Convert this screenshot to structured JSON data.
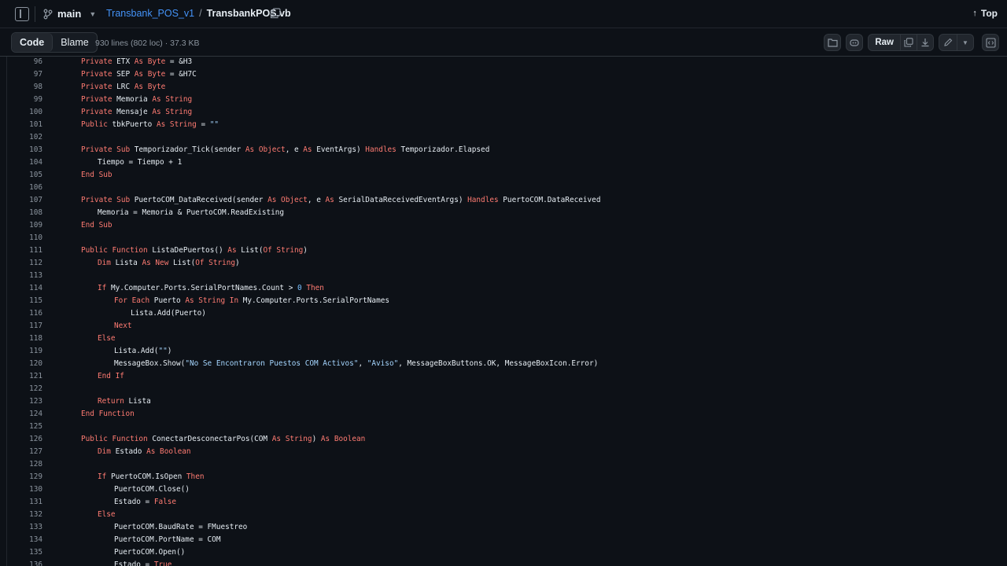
{
  "topbar": {
    "branch": "main",
    "repo": "Transbank_POS_v1",
    "separator": "/",
    "file": "TransbankPOS.vb",
    "top_label": "Top"
  },
  "filebar": {
    "tab_code": "Code",
    "tab_blame": "Blame",
    "info": "930 lines (802 loc) · 37.3 KB",
    "raw_label": "Raw"
  },
  "code": {
    "lines": [
      {
        "n": "96",
        "indent": 1,
        "tokens": [
          [
            "kw",
            "Private"
          ],
          [
            "t",
            " ETX "
          ],
          [
            "kw",
            "As"
          ],
          [
            "t",
            " "
          ],
          [
            "kw",
            "Byte"
          ],
          [
            "t",
            " = &H3"
          ]
        ]
      },
      {
        "n": "97",
        "indent": 1,
        "tokens": [
          [
            "kw",
            "Private"
          ],
          [
            "t",
            " SEP "
          ],
          [
            "kw",
            "As"
          ],
          [
            "t",
            " "
          ],
          [
            "kw",
            "Byte"
          ],
          [
            "t",
            " = &H7C"
          ]
        ]
      },
      {
        "n": "98",
        "indent": 1,
        "tokens": [
          [
            "kw",
            "Private"
          ],
          [
            "t",
            " LRC "
          ],
          [
            "kw",
            "As"
          ],
          [
            "t",
            " "
          ],
          [
            "kw",
            "Byte"
          ]
        ]
      },
      {
        "n": "99",
        "indent": 1,
        "tokens": [
          [
            "kw",
            "Private"
          ],
          [
            "t",
            " Memoria "
          ],
          [
            "kw",
            "As"
          ],
          [
            "t",
            " "
          ],
          [
            "kw",
            "String"
          ]
        ]
      },
      {
        "n": "100",
        "indent": 1,
        "tokens": [
          [
            "kw",
            "Private"
          ],
          [
            "t",
            " Mensaje "
          ],
          [
            "kw",
            "As"
          ],
          [
            "t",
            " "
          ],
          [
            "kw",
            "String"
          ]
        ]
      },
      {
        "n": "101",
        "indent": 1,
        "tokens": [
          [
            "kw",
            "Public"
          ],
          [
            "t",
            " tbkPuerto "
          ],
          [
            "kw",
            "As"
          ],
          [
            "t",
            " "
          ],
          [
            "kw",
            "String"
          ],
          [
            "t",
            " = "
          ],
          [
            "str",
            "\"\""
          ]
        ]
      },
      {
        "n": "102",
        "indent": 0,
        "tokens": []
      },
      {
        "n": "103",
        "indent": 1,
        "tokens": [
          [
            "kw",
            "Private"
          ],
          [
            "t",
            " "
          ],
          [
            "kw",
            "Sub"
          ],
          [
            "t",
            " Temporizador_Tick(sender "
          ],
          [
            "kw",
            "As"
          ],
          [
            "t",
            " "
          ],
          [
            "kw",
            "Object"
          ],
          [
            "t",
            ", e "
          ],
          [
            "kw",
            "As"
          ],
          [
            "t",
            " EventArgs) "
          ],
          [
            "kw",
            "Handles"
          ],
          [
            "t",
            " Temporizador.Elapsed"
          ]
        ]
      },
      {
        "n": "104",
        "indent": 2,
        "tokens": [
          [
            "t",
            "Tiempo = Tiempo + 1"
          ]
        ]
      },
      {
        "n": "105",
        "indent": 1,
        "tokens": [
          [
            "kw",
            "End Sub"
          ]
        ]
      },
      {
        "n": "106",
        "indent": 0,
        "tokens": []
      },
      {
        "n": "107",
        "indent": 1,
        "tokens": [
          [
            "kw",
            "Private"
          ],
          [
            "t",
            " "
          ],
          [
            "kw",
            "Sub"
          ],
          [
            "t",
            " PuertoCOM_DataReceived(sender "
          ],
          [
            "kw",
            "As"
          ],
          [
            "t",
            " "
          ],
          [
            "kw",
            "Object"
          ],
          [
            "t",
            ", e "
          ],
          [
            "kw",
            "As"
          ],
          [
            "t",
            " SerialDataReceivedEventArgs) "
          ],
          [
            "kw",
            "Handles"
          ],
          [
            "t",
            " PuertoCOM.DataReceived"
          ]
        ]
      },
      {
        "n": "108",
        "indent": 2,
        "tokens": [
          [
            "t",
            "Memoria = Memoria & PuertoCOM.ReadExisting"
          ]
        ]
      },
      {
        "n": "109",
        "indent": 1,
        "tokens": [
          [
            "kw",
            "End Sub"
          ]
        ]
      },
      {
        "n": "110",
        "indent": 0,
        "tokens": []
      },
      {
        "n": "111",
        "indent": 1,
        "tokens": [
          [
            "kw",
            "Public"
          ],
          [
            "t",
            " "
          ],
          [
            "kw",
            "Function"
          ],
          [
            "t",
            " ListaDePuertos() "
          ],
          [
            "kw",
            "As"
          ],
          [
            "t",
            " List("
          ],
          [
            "kw",
            "Of"
          ],
          [
            "t",
            " "
          ],
          [
            "kw",
            "String"
          ],
          [
            "t",
            ")"
          ]
        ]
      },
      {
        "n": "112",
        "indent": 2,
        "tokens": [
          [
            "kw",
            "Dim"
          ],
          [
            "t",
            " Lista "
          ],
          [
            "kw",
            "As"
          ],
          [
            "t",
            " "
          ],
          [
            "kw",
            "New"
          ],
          [
            "t",
            " List("
          ],
          [
            "kw",
            "Of"
          ],
          [
            "t",
            " "
          ],
          [
            "kw",
            "String"
          ],
          [
            "t",
            ")"
          ]
        ]
      },
      {
        "n": "113",
        "indent": 0,
        "tokens": []
      },
      {
        "n": "114",
        "indent": 2,
        "tokens": [
          [
            "kw",
            "If"
          ],
          [
            "t",
            " My.Computer.Ports.SerialPortNames.Count > "
          ],
          [
            "num",
            "0"
          ],
          [
            "t",
            " "
          ],
          [
            "kw",
            "Then"
          ]
        ]
      },
      {
        "n": "115",
        "indent": 3,
        "tokens": [
          [
            "kw",
            "For Each"
          ],
          [
            "t",
            " Puerto "
          ],
          [
            "kw",
            "As"
          ],
          [
            "t",
            " "
          ],
          [
            "kw",
            "String"
          ],
          [
            "t",
            " "
          ],
          [
            "kw",
            "In"
          ],
          [
            "t",
            " My.Computer.Ports.SerialPortNames"
          ]
        ]
      },
      {
        "n": "116",
        "indent": 4,
        "tokens": [
          [
            "t",
            "Lista.Add(Puerto)"
          ]
        ]
      },
      {
        "n": "117",
        "indent": 3,
        "tokens": [
          [
            "kw",
            "Next"
          ]
        ]
      },
      {
        "n": "118",
        "indent": 2,
        "tokens": [
          [
            "kw",
            "Else"
          ]
        ]
      },
      {
        "n": "119",
        "indent": 3,
        "tokens": [
          [
            "t",
            "Lista.Add("
          ],
          [
            "str",
            "\"\""
          ],
          [
            "t",
            ")"
          ]
        ]
      },
      {
        "n": "120",
        "indent": 3,
        "tokens": [
          [
            "t",
            "MessageBox.Show("
          ],
          [
            "str",
            "\"No Se Encontraron Puestos COM Activos\""
          ],
          [
            "t",
            ", "
          ],
          [
            "str",
            "\"Aviso\""
          ],
          [
            "t",
            ", MessageBoxButtons.OK, MessageBoxIcon.Error)"
          ]
        ]
      },
      {
        "n": "121",
        "indent": 2,
        "tokens": [
          [
            "kw",
            "End If"
          ]
        ]
      },
      {
        "n": "122",
        "indent": 0,
        "tokens": []
      },
      {
        "n": "123",
        "indent": 2,
        "tokens": [
          [
            "kw",
            "Return"
          ],
          [
            "t",
            " Lista"
          ]
        ]
      },
      {
        "n": "124",
        "indent": 1,
        "tokens": [
          [
            "kw",
            "End Function"
          ]
        ]
      },
      {
        "n": "125",
        "indent": 0,
        "tokens": []
      },
      {
        "n": "126",
        "indent": 1,
        "tokens": [
          [
            "kw",
            "Public"
          ],
          [
            "t",
            " "
          ],
          [
            "kw",
            "Function"
          ],
          [
            "t",
            " ConectarDesconectarPos(COM "
          ],
          [
            "kw",
            "As"
          ],
          [
            "t",
            " "
          ],
          [
            "kw",
            "String"
          ],
          [
            "t",
            ") "
          ],
          [
            "kw",
            "As"
          ],
          [
            "t",
            " "
          ],
          [
            "kw",
            "Boolean"
          ]
        ]
      },
      {
        "n": "127",
        "indent": 2,
        "tokens": [
          [
            "kw",
            "Dim"
          ],
          [
            "t",
            " Estado "
          ],
          [
            "kw",
            "As"
          ],
          [
            "t",
            " "
          ],
          [
            "kw",
            "Boolean"
          ]
        ]
      },
      {
        "n": "128",
        "indent": 0,
        "tokens": []
      },
      {
        "n": "129",
        "indent": 2,
        "tokens": [
          [
            "kw",
            "If"
          ],
          [
            "t",
            " PuertoCOM.IsOpen "
          ],
          [
            "kw",
            "Then"
          ]
        ]
      },
      {
        "n": "130",
        "indent": 3,
        "tokens": [
          [
            "t",
            "PuertoCOM.Close()"
          ]
        ]
      },
      {
        "n": "131",
        "indent": 3,
        "tokens": [
          [
            "t",
            "Estado = "
          ],
          [
            "kw",
            "False"
          ]
        ]
      },
      {
        "n": "132",
        "indent": 2,
        "tokens": [
          [
            "kw",
            "Else"
          ]
        ]
      },
      {
        "n": "133",
        "indent": 3,
        "tokens": [
          [
            "t",
            "PuertoCOM.BaudRate = FMuestreo"
          ]
        ]
      },
      {
        "n": "134",
        "indent": 3,
        "tokens": [
          [
            "t",
            "PuertoCOM.PortName = COM"
          ]
        ]
      },
      {
        "n": "135",
        "indent": 3,
        "tokens": [
          [
            "t",
            "PuertoCOM.Open()"
          ]
        ]
      },
      {
        "n": "136",
        "indent": 3,
        "tokens": [
          [
            "t",
            "Estado = "
          ],
          [
            "kw",
            "True"
          ]
        ]
      }
    ]
  },
  "colors": {
    "keyword": "#ff7b72",
    "string": "#a5d6ff",
    "number": "#79c0ff",
    "link": "#4493f8"
  }
}
